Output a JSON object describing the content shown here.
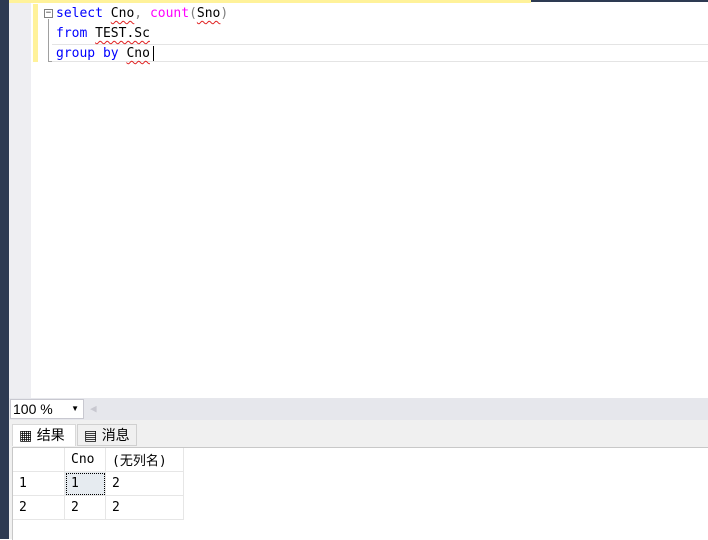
{
  "editor": {
    "lines": [
      {
        "tokens": [
          {
            "t": "select",
            "c": "kw"
          },
          {
            "t": " "
          },
          {
            "t": "Cno",
            "sq": true
          },
          {
            "t": ", ",
            "c": "gr"
          },
          {
            "t": "count",
            "c": "fn"
          },
          {
            "t": "(",
            "c": "gr"
          },
          {
            "t": "Sno",
            "sq": true
          },
          {
            "t": ")",
            "c": "gr"
          }
        ]
      },
      {
        "tokens": [
          {
            "t": "from",
            "c": "kw"
          },
          {
            "t": " "
          },
          {
            "t": "TEST.Sc",
            "sq": true
          }
        ]
      },
      {
        "tokens": [
          {
            "t": "group",
            "c": "kw"
          },
          {
            "t": " "
          },
          {
            "t": "by",
            "c": "kw"
          },
          {
            "t": " "
          },
          {
            "t": "Cno",
            "sq": true
          }
        ]
      }
    ]
  },
  "zoom": {
    "value": "100 %"
  },
  "tabs": [
    {
      "label": "结果",
      "icon": "grid-icon"
    },
    {
      "label": "消息",
      "icon": "messages-icon"
    }
  ],
  "results": {
    "columns": [
      "",
      "Cno",
      "(无列名)"
    ],
    "rows": [
      [
        "1",
        "1",
        "2"
      ],
      [
        "2",
        "2",
        "2"
      ]
    ]
  }
}
